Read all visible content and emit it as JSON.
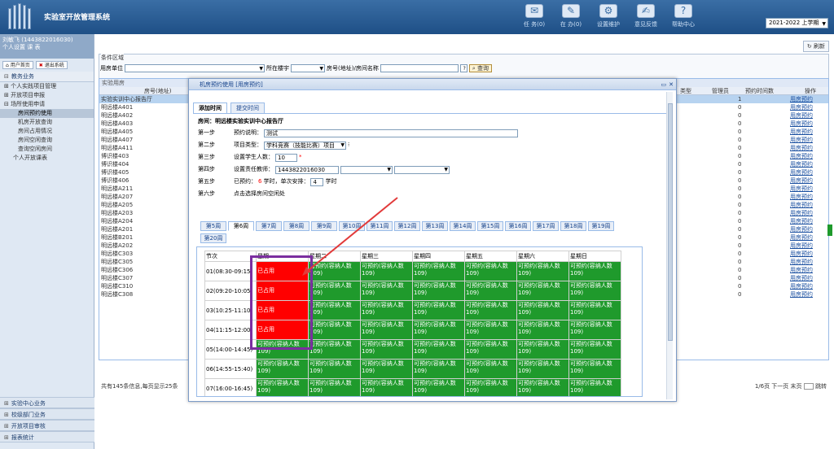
{
  "header": {
    "title": "实验室开放管理系统",
    "nav": [
      {
        "label": "任 务(0)",
        "icon": "task-icon"
      },
      {
        "label": "在 办(0)",
        "icon": "pending-icon"
      },
      {
        "label": "设置维护",
        "icon": "settings-icon"
      },
      {
        "label": "意见反馈",
        "icon": "feedback-icon"
      },
      {
        "label": "帮助中心",
        "icon": "help-icon"
      }
    ],
    "term": "2021-2022 上学期"
  },
  "sidebar": {
    "user_name": "刘敏飞 (1443822016030)",
    "user_links": "个人设置  课 表",
    "home_btn": "用户首页",
    "logout_btn": "退出系统",
    "section_edu": "教务业务",
    "items": [
      "个人实践项目管理",
      "开放项目申报",
      "场所使用申请"
    ],
    "subitems": [
      "房间预约使用",
      "机房开放查询",
      "房间占用情况",
      "房间空闲查询",
      "查询空闲房间"
    ],
    "item_last": "个人开放课表",
    "bottom": [
      "实验中心业务",
      "校级部门业务",
      "开放项目审核",
      "报表统计"
    ]
  },
  "main": {
    "refresh": "刷新",
    "filter": {
      "legend": "条件区域",
      "unit_label": "用房单位",
      "building_label": "所在楼宇",
      "room_label": "房号(地址)/房间名称",
      "query": "查询"
    },
    "grid": {
      "title": "实验用房",
      "col_room": "房号(地址)",
      "col_type": "类型",
      "col_admin": "管理员",
      "col_count": "预约时间数",
      "col_op": "操作",
      "rows": [
        {
          "room": "实验实训中心报告厅",
          "count": "1",
          "op": "用房预约"
        },
        {
          "room": "明远楼A401",
          "count": "0",
          "op": "用房预约"
        },
        {
          "room": "明远楼A402",
          "count": "0",
          "op": "用房预约"
        },
        {
          "room": "明远楼A403",
          "count": "0",
          "op": "用房预约"
        },
        {
          "room": "明远楼A405",
          "count": "0",
          "op": "用房预约"
        },
        {
          "room": "明远楼A407",
          "count": "0",
          "op": "用房预约"
        },
        {
          "room": "明远楼A411",
          "count": "0",
          "op": "用房预约"
        },
        {
          "room": "博识楼403",
          "count": "0",
          "op": "用房预约"
        },
        {
          "room": "博识楼404",
          "count": "0",
          "op": "用房预约"
        },
        {
          "room": "博识楼405",
          "count": "0",
          "op": "用房预约"
        },
        {
          "room": "博识楼406",
          "count": "0",
          "op": "用房预约"
        },
        {
          "room": "明远楼A211",
          "count": "0",
          "op": "用房预约"
        },
        {
          "room": "明远楼A207",
          "count": "0",
          "op": "用房预约"
        },
        {
          "room": "明远楼A205",
          "count": "0",
          "op": "用房预约"
        },
        {
          "room": "明远楼A203",
          "count": "0",
          "op": "用房预约"
        },
        {
          "room": "明远楼A204",
          "count": "0",
          "op": "用房预约"
        },
        {
          "room": "明远楼A201",
          "count": "0",
          "op": "用房预约"
        },
        {
          "room": "明远楼B201",
          "count": "0",
          "op": "用房预约"
        },
        {
          "room": "明远楼A202",
          "count": "0",
          "op": "用房预约"
        },
        {
          "room": "明远楼C303",
          "count": "0",
          "op": "用房预约"
        },
        {
          "room": "明远楼C305",
          "count": "0",
          "op": "用房预约"
        },
        {
          "room": "明远楼C306",
          "count": "0",
          "op": "用房预约"
        },
        {
          "room": "明远楼C307",
          "count": "0",
          "op": "用房预约"
        },
        {
          "room": "明远楼C310",
          "count": "0",
          "op": "用房预约"
        },
        {
          "room": "明远楼C308",
          "count": "0",
          "op": "用房预约"
        }
      ],
      "footer": "共有145条信息,每页显示25条",
      "pager": "1/6页  下一页  末页",
      "jump": "跳转"
    }
  },
  "modal": {
    "title": "机房预约使用 [用房预约]",
    "tab_add": "添加时间",
    "tab_submit": "提交时间",
    "room_line": "房间：明远楼实验实训中心报告厅",
    "steps": {
      "s1": "第一步",
      "s1_label": "预约说明：",
      "s1_value": "测试",
      "s2": "第二步",
      "s2_label": "项目类型：",
      "s2_value": "学科竞赛（技能比赛）项目",
      "s3": "第三步",
      "s3_label": "设置学生人数：",
      "s3_value": "10",
      "s3_star": "*",
      "s4": "第四步",
      "s4_label": "设置责任教师：",
      "s4_value": "1443822016030",
      "s5": "第五步",
      "s5_pre": "已预约：",
      "s5_hours": "6",
      "s5_mid": "学时，单次安排：",
      "s5_value": "4",
      "s5_suffix": "学时",
      "s6": "第六步",
      "s6_label": "点击选择房间空闲处"
    },
    "weeks": [
      "第5周",
      "第6周",
      "第7周",
      "第8周",
      "第9周",
      "第10周",
      "第11周",
      "第12周",
      "第13周",
      "第14周",
      "第15周",
      "第16周",
      "第17周",
      "第18周",
      "第19周",
      "第20周"
    ],
    "active_week": "第6周",
    "schedule": {
      "header_session": "节次",
      "days": [
        "星期一",
        "星期二",
        "星期三",
        "星期四",
        "星期五",
        "星期六",
        "星期日"
      ],
      "sessions": [
        "01(08:30-09:15)",
        "02(09:20-10:05)",
        "03(10:25-11:10)",
        "04(11:15-12:00)",
        "05(14:00-14:45)",
        "06(14:55-15:40)",
        "07(16:00-16:45)"
      ],
      "avail_text": "可预约(容纳人数109)",
      "used_text": "已占用"
    }
  }
}
